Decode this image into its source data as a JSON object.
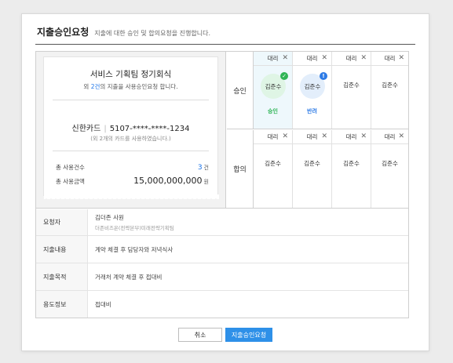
{
  "header": {
    "title": "지출승인요청",
    "description": "지출에 대한 승인 및 합의요청을 진행합니다."
  },
  "receipt": {
    "title": "서비스 기획팀 정기회식",
    "sub_prefix": "외",
    "sub_count": "2건",
    "sub_suffix": "의 지출을 사용승인요청 합니다.",
    "card_name": "신한카드",
    "card_number": "5107-****-****-1234",
    "card_note": "(외 2개의 카드를 사용하였습니다.)",
    "total_count_label": "총 사용건수",
    "total_count_value": "3",
    "total_count_unit": "건",
    "total_amount_label": "총 사용금액",
    "total_amount_value": "15,000,000,000",
    "total_amount_unit": "원"
  },
  "approval": {
    "label": "승인",
    "cells": [
      {
        "role": "대리",
        "name": "김준수",
        "status": "승인",
        "state": "approved"
      },
      {
        "role": "대리",
        "name": "김준수",
        "status": "반려",
        "state": "rejected"
      },
      {
        "role": "대리",
        "name": "김준수",
        "status": "",
        "state": "pending"
      },
      {
        "role": "대리",
        "name": "김준수",
        "status": "",
        "state": "pending"
      }
    ]
  },
  "agreement": {
    "label": "합의",
    "cells": [
      {
        "role": "대리",
        "name": "김준수"
      },
      {
        "role": "대리",
        "name": "김준수"
      },
      {
        "role": "대리",
        "name": "김준수"
      },
      {
        "role": "대리",
        "name": "김준수"
      }
    ]
  },
  "info": [
    {
      "label": "요청자",
      "value": "김더존 사원",
      "sub": "더존비즈온(전략본부)미래전략기획팀"
    },
    {
      "label": "지출내용",
      "value": "계약 체결 후 담당자와 저녁식사",
      "sub": ""
    },
    {
      "label": "지출목적",
      "value": "거래처 계약 체결 후 접대비",
      "sub": ""
    },
    {
      "label": "용도정보",
      "value": "접대비",
      "sub": ""
    }
  ],
  "buttons": {
    "cancel": "취소",
    "submit": "지출승인요청"
  },
  "icons": {
    "remove": "close-icon",
    "approved_badge": "check-icon",
    "rejected_badge": "exclamation-icon"
  },
  "colors": {
    "accent": "#2e90e8",
    "approved": "#2fb456",
    "rejected": "#2e7be6",
    "highlight_column": "#eef8fc"
  }
}
